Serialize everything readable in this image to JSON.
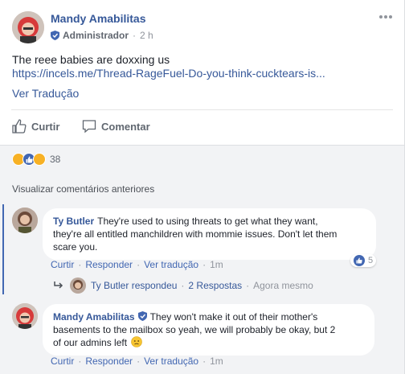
{
  "post": {
    "author": "Mandy Amabilitas",
    "role": "Administrador",
    "time": "2 h",
    "text": "The reee babies are doxxing us",
    "link": "https://incels.me/Thread-RageFuel-Do-you-think-cucktears-is...",
    "see_translation": "Ver Tradução",
    "actions": {
      "like": "Curtir",
      "comment": "Comentar"
    },
    "reaction_count": "38"
  },
  "comments_section": {
    "view_previous": "Visualizar comentários anteriores",
    "comments": [
      {
        "author": "Ty Butler",
        "text_line1": "They're used to using threats to get what they want,",
        "text_line2": "they're all entitled manchildren with mommie issues. Don't let them",
        "text_line3": "scare you.",
        "action_like": "Curtir",
        "action_reply": "Responder",
        "action_translate": "Ver tradução",
        "time": "1m",
        "likes": "5",
        "replies": {
          "author": "Ty Butler",
          "verb": "respondeu",
          "count_label": "2 Respostas",
          "time": "Agora mesmo"
        }
      },
      {
        "author": "Mandy Amabilitas",
        "text_line1": "They won't make it out of their mother's",
        "text_line2": "basements to the mailbox so yeah, we will probably be okay, but 2",
        "text_line3": "of our admins left",
        "action_like": "Curtir",
        "action_reply": "Responder",
        "action_translate": "Ver tradução",
        "time": "1m"
      }
    ]
  },
  "colors": {
    "link_blue": "#365899",
    "accent_blue": "#4267b2",
    "muted_gray": "#90949c",
    "bubble_bg": "#f2f3f5"
  }
}
